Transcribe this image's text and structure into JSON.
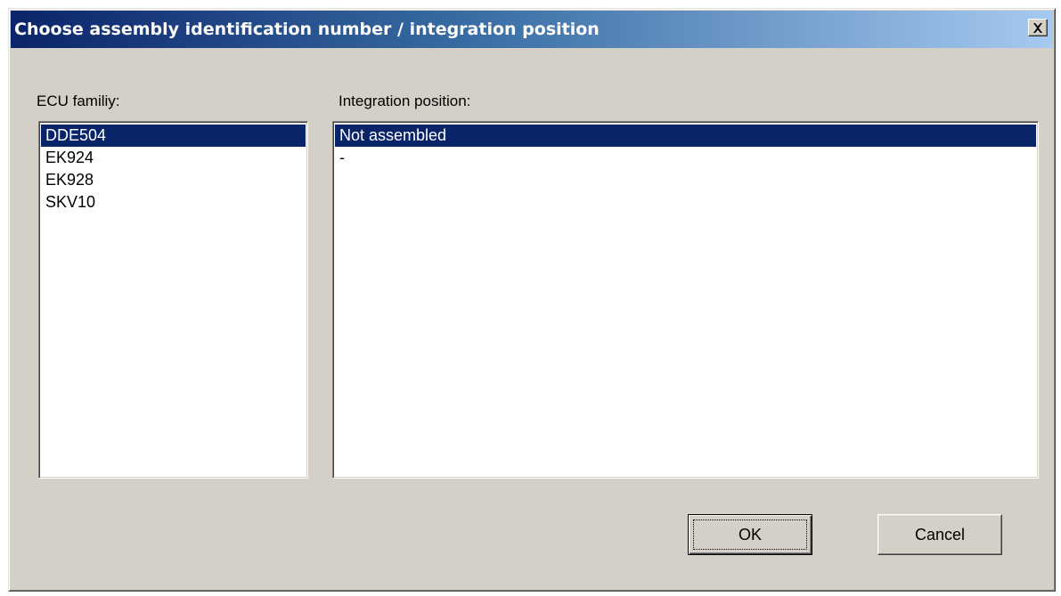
{
  "window": {
    "title": "Choose assembly identification number / integration position",
    "close_icon": "close-icon"
  },
  "ecu_family": {
    "label": "ECU familiy:",
    "items": [
      "DDE504",
      "EK924",
      "EK928",
      "SKV10"
    ],
    "selected": "DDE504"
  },
  "integration_position": {
    "label": "Integration position:",
    "items": [
      "Not assembled",
      "-"
    ],
    "selected": "Not assembled"
  },
  "buttons": {
    "ok_label": "OK",
    "cancel_label": "Cancel"
  },
  "colors": {
    "selection": "#0a246a",
    "dialog_face": "#d4d0c8",
    "title_start": "#0a246a",
    "title_end": "#a6caf0"
  }
}
